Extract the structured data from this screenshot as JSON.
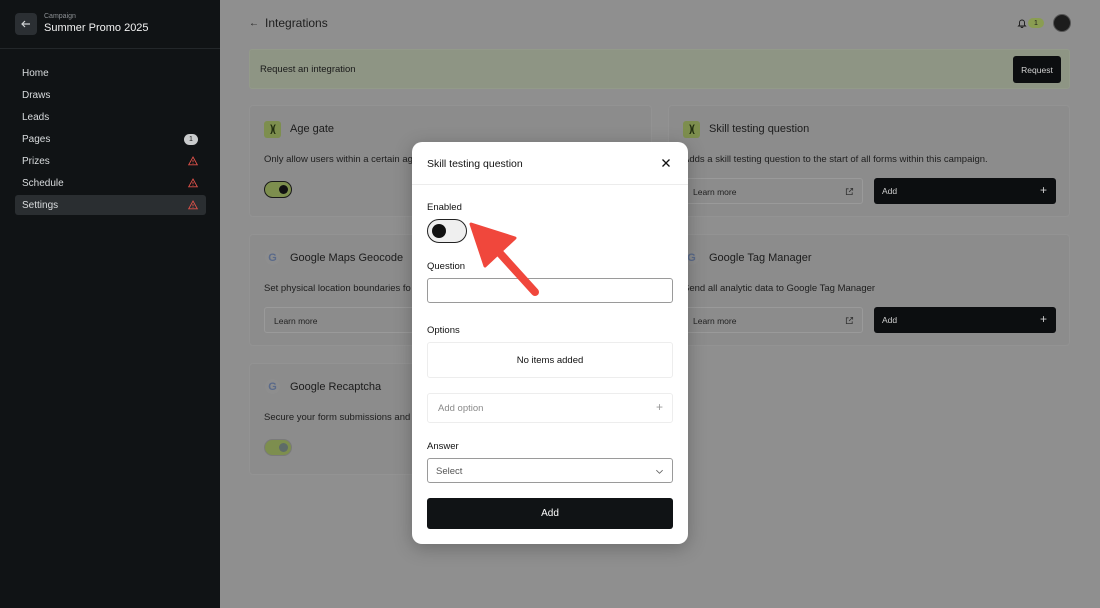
{
  "sidebar": {
    "kicker": "Campaign",
    "title": "Summer Promo 2025",
    "items": [
      {
        "label": "Home"
      },
      {
        "label": "Draws"
      },
      {
        "label": "Leads"
      },
      {
        "label": "Pages",
        "badge": "1"
      },
      {
        "label": "Prizes",
        "warning": true
      },
      {
        "label": "Schedule",
        "warning": true
      },
      {
        "label": "Settings",
        "warning": true,
        "active": true
      }
    ]
  },
  "header": {
    "title": "Integrations",
    "notification_count": "1"
  },
  "request_bar": {
    "text": "Request an integration",
    "button": "Request"
  },
  "cards": {
    "age_gate": {
      "title": "Age gate",
      "desc": "Only allow users within a certain ag"
    },
    "skill": {
      "title": "Skill testing question",
      "desc": "Adds a skill testing question to the start of all forms within this campaign.",
      "learn": "Learn more",
      "add": "Add"
    },
    "maps": {
      "title": "Google Maps Geocode",
      "desc": "Set physical location boundaries fo",
      "learn": "Learn more"
    },
    "gtm": {
      "title": "Google Tag Manager",
      "desc": "Send all analytic data to Google Tag Manager",
      "learn": "Learn more",
      "add": "Add"
    },
    "recaptcha": {
      "title": "Google Recaptcha",
      "desc": "Secure your form submissions and"
    }
  },
  "modal": {
    "title": "Skill testing question",
    "enabled_label": "Enabled",
    "enabled": false,
    "question_label": "Question",
    "question_value": "",
    "options_label": "Options",
    "empty_text": "No items added",
    "add_option": "Add option",
    "answer_label": "Answer",
    "answer_placeholder": "Select",
    "submit": "Add"
  },
  "colors": {
    "accent_green": "#a6c45f",
    "annotation_arrow": "#f0473c",
    "dark": "#101315"
  }
}
